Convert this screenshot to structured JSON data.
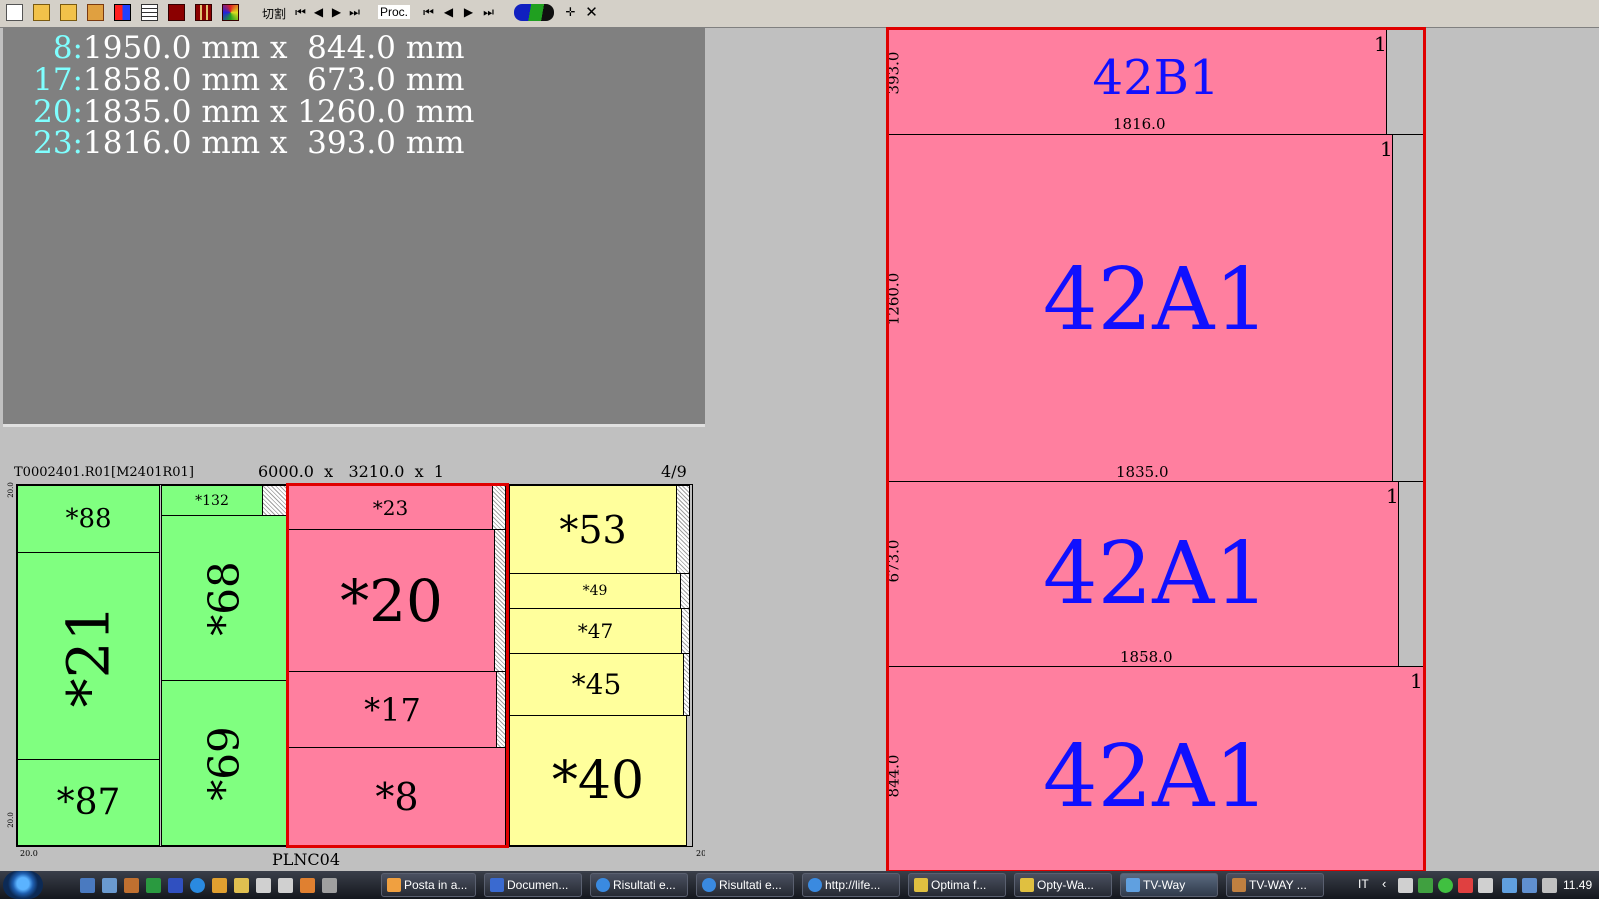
{
  "toolbar": {
    "cut_label": "切割",
    "proc_label": "Proc.",
    "icons": [
      "new-file-icon",
      "open-folder-icon",
      "open-folder-icon",
      "open-folder-icon",
      "color-icon",
      "list-icon",
      "panel-icon",
      "grid-icon",
      "palette-icon",
      "first-icon",
      "prev-icon",
      "next-icon",
      "last-icon",
      "first-icon",
      "prev-icon",
      "next-icon",
      "last-icon",
      "tool-icon",
      "crosshair-icon",
      "close-icon"
    ]
  },
  "info": {
    "lines": [
      {
        "n": "8:",
        "text": "1950.0 mm x  844.0 mm"
      },
      {
        "n": "17:",
        "text": "1858.0 mm x  673.0 mm"
      },
      {
        "n": "20:",
        "text": "1835.0 mm x 1260.0 mm"
      },
      {
        "n": "23:",
        "text": "1816.0 mm x  393.0 mm"
      }
    ]
  },
  "layout": {
    "file": "T0002401.R01[M2401R01]",
    "dims": "6000.0  x   3210.0  x  1",
    "page": "4/9",
    "name": "PLNC04",
    "edge_tl": "20.0",
    "edge_bl": "20.0",
    "edge_b": "20.0",
    "edge_br": "20",
    "pieces": {
      "p88": "*88",
      "p21": "*21",
      "p87": "*87",
      "p132": "*132",
      "p68": "*68",
      "p69": "*69",
      "p23": "*23",
      "p20": "*20",
      "p17": "*17",
      "p8": "*8",
      "p53": "*53",
      "p49": "*49",
      "p47": "*47",
      "p45": "*45",
      "p40": "*40"
    }
  },
  "right": {
    "blocks": [
      {
        "label": "42B1",
        "width": "1816.0",
        "height": "393.0",
        "count": "1"
      },
      {
        "label": "42A1",
        "width": "1835.0",
        "height": "1260.0",
        "count": "1"
      },
      {
        "label": "42A1",
        "width": "1858.0",
        "height": "673.0",
        "count": "1"
      },
      {
        "label": "42A1",
        "width": "",
        "height": "844.0",
        "count": "1"
      }
    ]
  },
  "taskbar": {
    "items": [
      {
        "label": "Posta in a...",
        "color": "#f0a040"
      },
      {
        "label": "Documen...",
        "color": "#3a6ad0"
      },
      {
        "label": "Risultati e...",
        "color": "#3a8ae0"
      },
      {
        "label": "Risultati e...",
        "color": "#3a8ae0"
      },
      {
        "label": "http://life...",
        "color": "#3a8ae0"
      },
      {
        "label": "Optima f...",
        "color": "#e0c040"
      },
      {
        "label": "Opty-Wa...",
        "color": "#e0c040"
      },
      {
        "label": "TV-Way",
        "color": "#60a0e0"
      },
      {
        "label": "TV-WAY ...",
        "color": "#c08040"
      }
    ],
    "lang": "IT",
    "clock": "11.49"
  },
  "colors": {
    "green": "#80ff80",
    "pink": "#ff7f9f",
    "yellow": "#ffff9c",
    "red": "#e00000",
    "blue_label": "#1010ff",
    "cyan": "#7fffff"
  }
}
